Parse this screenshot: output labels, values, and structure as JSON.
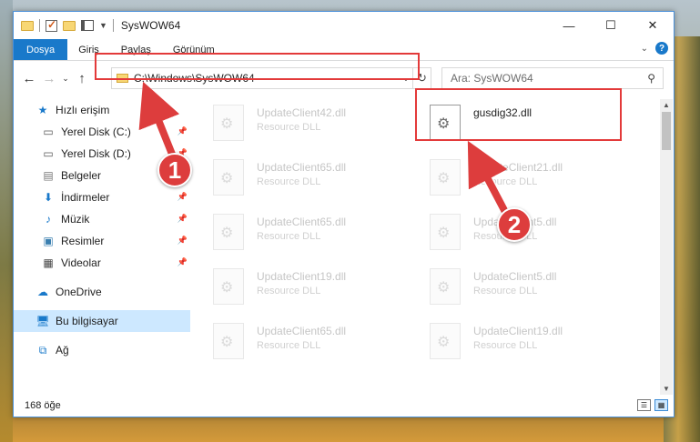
{
  "window": {
    "title": "SysWOW64"
  },
  "ribbon": {
    "tabs": [
      "Dosya",
      "Giriş",
      "Paylaş",
      "Görünüm"
    ]
  },
  "nav": {
    "address": "C:\\Windows\\SysWOW64",
    "search_placeholder": "Ara: SysWOW64"
  },
  "sidebar": {
    "items": [
      {
        "label": "Hızlı erişim",
        "icon": "star-icon"
      },
      {
        "label": "Yerel Disk (C:)",
        "icon": "drive-icon"
      },
      {
        "label": "Yerel Disk (D:)",
        "icon": "drive-icon"
      },
      {
        "label": "Belgeler",
        "icon": "document-icon"
      },
      {
        "label": "İndirmeler",
        "icon": "download-icon"
      },
      {
        "label": "Müzik",
        "icon": "music-icon"
      },
      {
        "label": "Resimler",
        "icon": "pictures-icon"
      },
      {
        "label": "Videolar",
        "icon": "video-icon"
      },
      {
        "label": "OneDrive",
        "icon": "cloud-icon"
      },
      {
        "label": "Bu bilgisayar",
        "icon": "computer-icon"
      },
      {
        "label": "Ağ",
        "icon": "network-icon"
      }
    ]
  },
  "files": [
    {
      "name": "UpdateClient42.dll",
      "type": "Resource DLL"
    },
    {
      "name": "gusdig32.dll",
      "type": ""
    },
    {
      "name": "UpdateClient65.dll",
      "type": "Resource DLL"
    },
    {
      "name": "UpdateClient21.dll",
      "type": "Resource DLL"
    },
    {
      "name": "UpdateClient65.dll",
      "type": "Resource DLL"
    },
    {
      "name": "UpdateClient5.dll",
      "type": "Resource DLL"
    },
    {
      "name": "UpdateClient19.dll",
      "type": "Resource DLL"
    },
    {
      "name": "UpdateClient5.dll",
      "type": "Resource DLL"
    },
    {
      "name": "UpdateClient65.dll",
      "type": "Resource DLL"
    },
    {
      "name": "UpdateClient19.dll",
      "type": "Resource DLL"
    }
  ],
  "status": {
    "count": "168 öğe"
  },
  "annotations": {
    "one": "1",
    "two": "2"
  },
  "colors": {
    "accent": "#1979ca",
    "highlight": "#e33a3a",
    "selected": "#cde8ff"
  }
}
